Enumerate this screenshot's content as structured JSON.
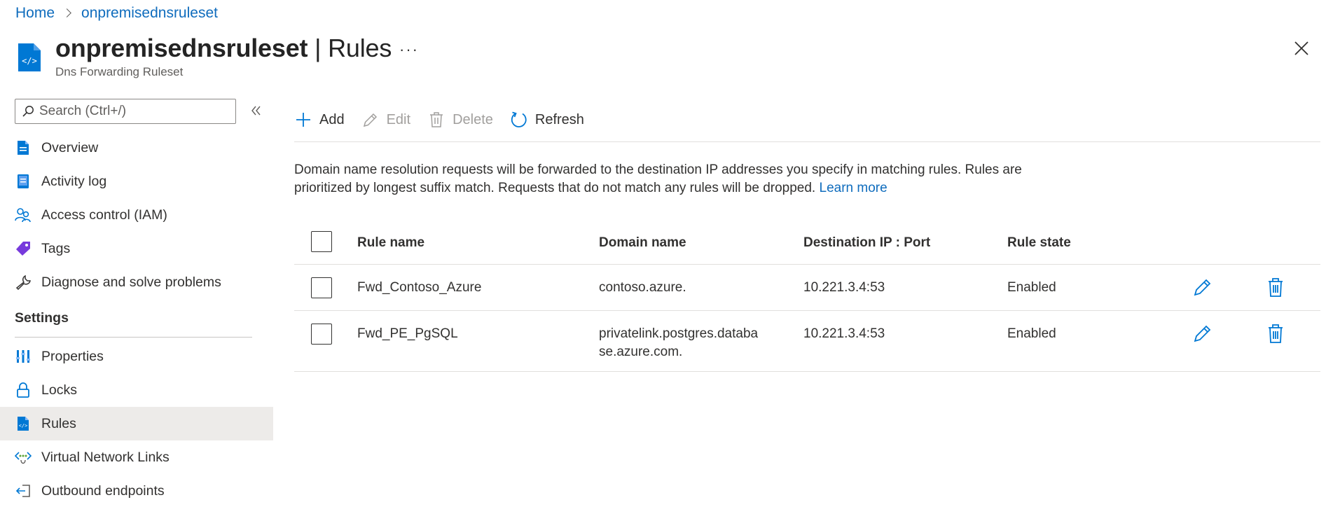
{
  "breadcrumb": {
    "home": "Home",
    "resource": "onpremisednsruleset"
  },
  "header": {
    "title": "onpremisednsruleset",
    "separator": "|",
    "section": "Rules",
    "subtitle": "Dns Forwarding Ruleset",
    "more_label": "···"
  },
  "search": {
    "placeholder": "Search (Ctrl+/)"
  },
  "nav": {
    "items": [
      {
        "label": "Overview",
        "icon": "overview-icon"
      },
      {
        "label": "Activity log",
        "icon": "activity-log-icon"
      },
      {
        "label": "Access control (IAM)",
        "icon": "iam-icon"
      },
      {
        "label": "Tags",
        "icon": "tag-icon"
      },
      {
        "label": "Diagnose and solve problems",
        "icon": "wrench-icon"
      }
    ],
    "section_label": "Settings",
    "settings_items": [
      {
        "label": "Properties",
        "icon": "properties-icon"
      },
      {
        "label": "Locks",
        "icon": "lock-icon"
      },
      {
        "label": "Rules",
        "icon": "rules-icon",
        "active": true
      },
      {
        "label": "Virtual Network Links",
        "icon": "vnet-link-icon"
      },
      {
        "label": "Outbound endpoints",
        "icon": "outbound-endpoint-icon"
      }
    ]
  },
  "toolbar": {
    "add_label": "Add",
    "edit_label": "Edit",
    "delete_label": "Delete",
    "refresh_label": "Refresh"
  },
  "description": {
    "text": "Domain name resolution requests will be forwarded to the destination IP addresses you specify in matching rules. Rules are prioritized by longest suffix match. Requests that do not match any rules will be dropped.",
    "link": "Learn more"
  },
  "table": {
    "columns": [
      "Rule name",
      "Domain name",
      "Destination IP : Port",
      "Rule state"
    ],
    "rows": [
      {
        "name": "Fwd_Contoso_Azure",
        "domain": "contoso.azure.",
        "ip": "10.221.3.4:53",
        "state": "Enabled"
      },
      {
        "name": "Fwd_PE_PgSQL",
        "domain": "privatelink.postgres.database.azure.com.",
        "ip": "10.221.3.4:53",
        "state": "Enabled"
      }
    ]
  },
  "colors": {
    "link": "#0f6cbd",
    "azure_blue": "#0078d4",
    "active_bg": "#edebe9"
  }
}
